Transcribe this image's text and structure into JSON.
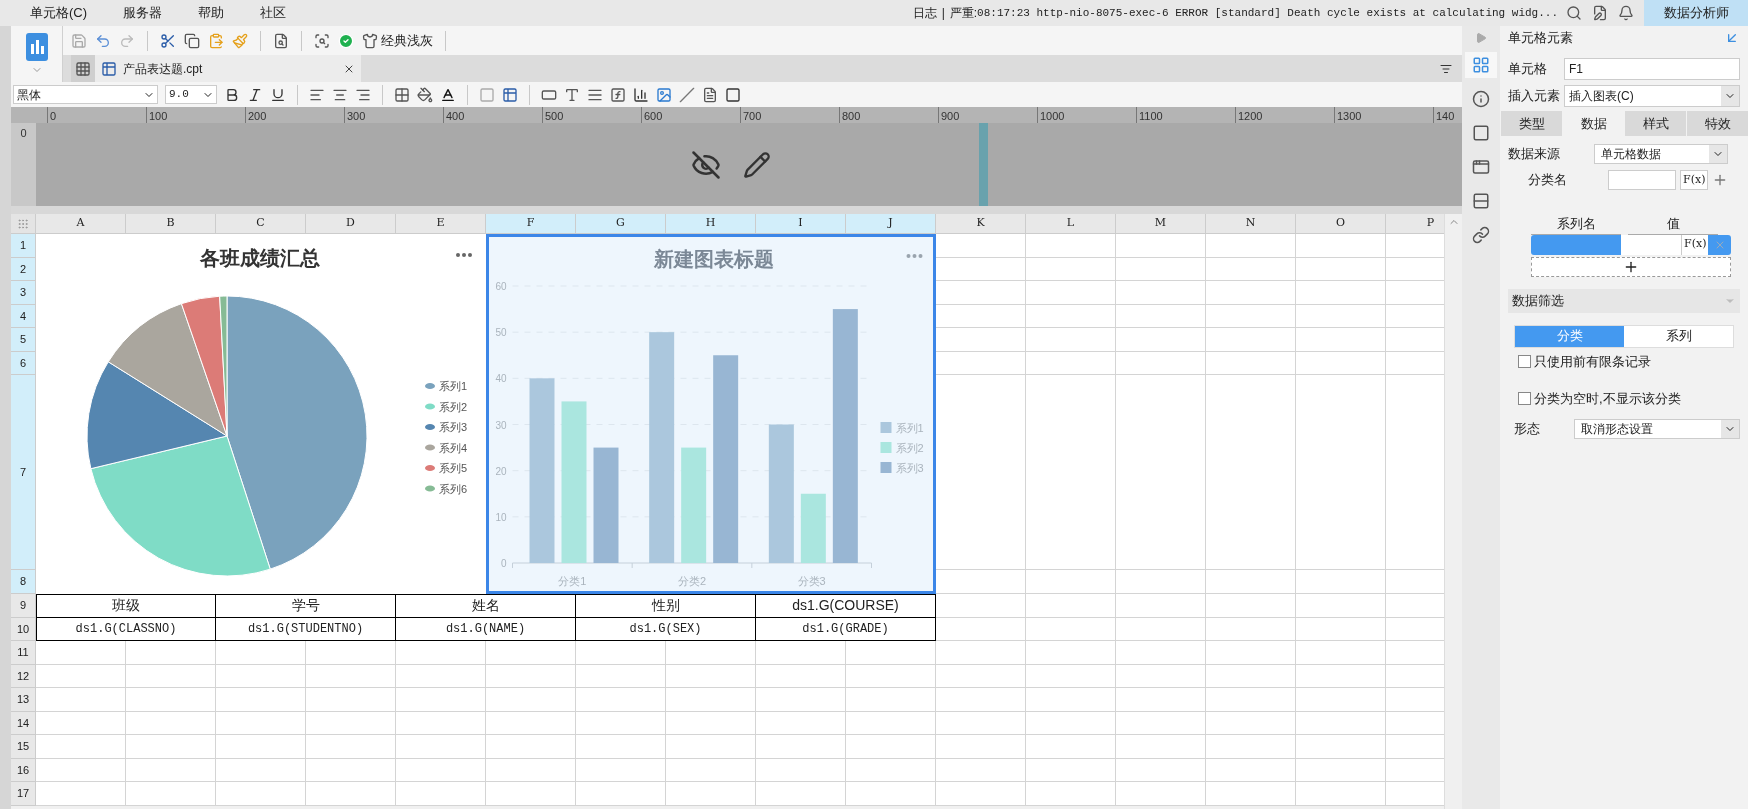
{
  "menu": [
    "单元格(C)",
    "服务器",
    "帮助",
    "社区"
  ],
  "log": {
    "label": "日志",
    "separator": "|",
    "level": "严重:",
    "message": "08:17:23 http-nio-8075-exec-6 ERROR [standard] Death cycle exists at calculating widg..."
  },
  "role_button": "数据分析师",
  "toolbar": {
    "theme": "经典浅灰"
  },
  "file_tab": {
    "name": "产品表达题.cpt"
  },
  "format": {
    "font": "黑体",
    "size": "9.0"
  },
  "ruler": [
    "0",
    "100",
    "200",
    "300",
    "400",
    "500",
    "600",
    "700",
    "800",
    "900",
    "1000",
    "1100",
    "1200",
    "1300",
    "140"
  ],
  "design_ruler": "0",
  "columns": [
    {
      "label": "A",
      "selected": false
    },
    {
      "label": "B",
      "selected": false
    },
    {
      "label": "C",
      "selected": false
    },
    {
      "label": "D",
      "selected": false
    },
    {
      "label": "E",
      "selected": false
    },
    {
      "label": "F",
      "selected": true
    },
    {
      "label": "G",
      "selected": true
    },
    {
      "label": "H",
      "selected": true
    },
    {
      "label": "I",
      "selected": true
    },
    {
      "label": "J",
      "selected": true
    },
    {
      "label": "K",
      "selected": false
    },
    {
      "label": "L",
      "selected": false
    },
    {
      "label": "M",
      "selected": false
    },
    {
      "label": "N",
      "selected": false
    },
    {
      "label": "O",
      "selected": false
    },
    {
      "label": "P",
      "selected": false
    }
  ],
  "rows": [
    {
      "label": "1",
      "selected": true
    },
    {
      "label": "2",
      "selected": true
    },
    {
      "label": "3",
      "selected": true
    },
    {
      "label": "4",
      "selected": true
    },
    {
      "label": "5",
      "selected": true
    },
    {
      "label": "6",
      "selected": true
    },
    {
      "label": "7",
      "selected": true
    },
    {
      "label": "8",
      "selected": true
    },
    {
      "label": "9",
      "selected": false
    },
    {
      "label": "10",
      "selected": false
    },
    {
      "label": "11",
      "selected": false
    },
    {
      "label": "12",
      "selected": false
    },
    {
      "label": "13",
      "selected": false
    },
    {
      "label": "14",
      "selected": false
    },
    {
      "label": "15",
      "selected": false
    },
    {
      "label": "16",
      "selected": false
    },
    {
      "label": "17",
      "selected": false
    }
  ],
  "pie_chart": {
    "title": "各班成绩汇总",
    "legend": [
      {
        "label": "系列1",
        "color": "#7aa2bd"
      },
      {
        "label": "系列2",
        "color": "#7fdcc6"
      },
      {
        "label": "系列3",
        "color": "#5586b0"
      },
      {
        "label": "系列4",
        "color": "#aaa69e"
      },
      {
        "label": "系列5",
        "color": "#dc7b77"
      },
      {
        "label": "系列6",
        "color": "#86bb95"
      }
    ]
  },
  "bar_chart": {
    "title": "新建图表标题",
    "chart_data": {
      "type": "bar",
      "grid": true,
      "legend": true,
      "categories": [
        "分类1",
        "分类2",
        "分类3"
      ],
      "ylim": [
        0,
        60
      ],
      "yticks": [
        0,
        10,
        20,
        30,
        40,
        50,
        60
      ],
      "series": [
        {
          "name": "系列1",
          "color": "#abc7dd",
          "values": [
            40,
            50,
            30
          ]
        },
        {
          "name": "系列2",
          "color": "#aae6df",
          "values": [
            35,
            25,
            15
          ]
        },
        {
          "name": "系列3",
          "color": "#98b6d3",
          "values": [
            25,
            45,
            55
          ]
        }
      ]
    }
  },
  "table": {
    "header": [
      "班级",
      "学号",
      "姓名",
      "性别",
      "ds1.G(COURSE)"
    ],
    "row": [
      "ds1.G(CLASSNO)",
      "ds1.G(STUDENTNO)",
      "ds1.G(NAME)",
      "ds1.G(SEX)",
      "ds1.G(GRADE)"
    ]
  },
  "panel": {
    "title": "单元格元素",
    "nav": [
      {
        "selected": true
      },
      {
        "selected": false
      },
      {
        "selected": false
      },
      {
        "selected": false
      },
      {
        "selected": false
      },
      {
        "selected": false
      }
    ],
    "cell_label": "单元格",
    "cell_value": "F1",
    "insert_label": "插入元素",
    "insert_value": "插入图表(C)",
    "tabs": [
      {
        "label": "类型",
        "selected": false
      },
      {
        "label": "数据",
        "selected": true
      },
      {
        "label": "样式",
        "selected": false
      },
      {
        "label": "特效",
        "selected": false
      }
    ],
    "source_label": "数据来源",
    "source_value": "单元格数据",
    "category_label": "分类名",
    "category_fx": "F(x)",
    "series_header": "系列名",
    "value_header": "值",
    "series_fx": "F(x)",
    "filter_title": "数据筛选",
    "filter_tabs": [
      {
        "label": "分类",
        "selected": true
      },
      {
        "label": "系列",
        "selected": false
      }
    ],
    "checks": [
      {
        "label": "只使用前有限条记录",
        "checked": false
      },
      {
        "label": "分类为空时,不显示该分类",
        "checked": false
      }
    ],
    "shape_label": "形态",
    "shape_value": "取消形态设置"
  }
}
